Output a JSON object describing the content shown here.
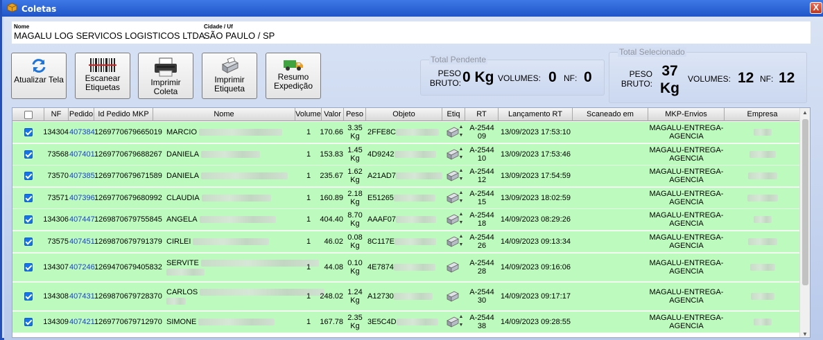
{
  "window": {
    "title": "Coletas",
    "close_label": "X"
  },
  "info": {
    "nome_label": "Nome",
    "nome_value": "MAGALU LOG SERVICOS LOGISTICOS LTDA",
    "cidade_label": "Cidade / Uf",
    "cidade_value": "SÃO PAULO / SP"
  },
  "toolbar": {
    "atualizar": "Atualizar Tela",
    "escanear": "Escanear Etiquetas",
    "imprimir_coleta": "Imprimir Coleta",
    "imprimir_etiqueta": "Imprimir Etiqueta",
    "resumo": "Resumo Expedição"
  },
  "pendente": {
    "title": "Total Pendente",
    "peso_label": "PESO BRUTO:",
    "peso_value": "0 Kg",
    "volumes_label": "VOLUMES:",
    "volumes_value": "0",
    "nf_label": "NF:",
    "nf_value": "0"
  },
  "selecionado": {
    "title": "Total Selecionado",
    "peso_label": "PESO BRUTO:",
    "peso_value": "37 Kg",
    "volumes_label": "VOLUMES:",
    "volumes_value": "12",
    "nf_label": "NF:",
    "nf_value": "12"
  },
  "columns": {
    "nf": "NF",
    "pedido": "Pedido",
    "id_mkp": "Id Pedido MKP",
    "nome": "Nome",
    "volume": "Volume",
    "valor": "Valor",
    "peso": "Peso",
    "objeto": "Objeto",
    "etiq": "Etiq",
    "rt": "RT",
    "lancamento": "Lançamento RT",
    "scaneado": "Scaneado em",
    "mkp_envios": "MKP-Envios",
    "empresa": "Empresa"
  },
  "rows": [
    {
      "nf": "134304",
      "pedido": "407384",
      "id_mkp": "1269770679665019",
      "nome": "MARCIO",
      "volume": "1",
      "valor": "170.66",
      "peso": "3.35 Kg",
      "objeto": "2FFE8C",
      "rt": "A-254409",
      "lancamento": "13/09/2023 17:53:10",
      "mkp": "MAGALU-ENTREGA-AGENCIA"
    },
    {
      "nf": "73568",
      "pedido": "407401",
      "id_mkp": "1269770679688267",
      "nome": "DANIELA",
      "volume": "1",
      "valor": "153.83",
      "peso": "1.45 Kg",
      "objeto": "4D9242",
      "rt": "A-254410",
      "lancamento": "13/09/2023 17:53:46",
      "mkp": "MAGALU-ENTREGA-AGENCIA"
    },
    {
      "nf": "73570",
      "pedido": "407385",
      "id_mkp": "1269770679671589",
      "nome": "DANIELA",
      "volume": "1",
      "valor": "235.67",
      "peso": "1.62 Kg",
      "objeto": "A21AD7",
      "rt": "A-254412",
      "lancamento": "13/09/2023 17:54:59",
      "mkp": "MAGALU-ENTREGA-AGENCIA"
    },
    {
      "nf": "73571",
      "pedido": "407396",
      "id_mkp": "1269770679680992",
      "nome": "CLAUDIA",
      "volume": "1",
      "valor": "160.89",
      "peso": "2.18 Kg",
      "objeto": "E51265",
      "rt": "A-254415",
      "lancamento": "13/09/2023 18:02:59",
      "mkp": "MAGALU-ENTREGA-AGENCIA"
    },
    {
      "nf": "134306",
      "pedido": "407447",
      "id_mkp": "1269870679755845",
      "nome": "ANGELA",
      "volume": "1",
      "valor": "404.40",
      "peso": "8.70 Kg",
      "objeto": "AAAF07",
      "rt": "A-254418",
      "lancamento": "14/09/2023 08:29:26",
      "mkp": "MAGALU-ENTREGA-AGENCIA"
    },
    {
      "nf": "73575",
      "pedido": "407451",
      "id_mkp": "1269870679791379",
      "nome": "CIRLEI",
      "volume": "1",
      "valor": "46.02",
      "peso": "0.08 Kg",
      "objeto": "8C117E",
      "rt": "A-254426",
      "lancamento": "14/09/2023 09:13:34",
      "mkp": "MAGALU-ENTREGA-AGENCIA"
    },
    {
      "nf": "134307",
      "pedido": "407246",
      "id_mkp": "1269470679405832",
      "nome": "SERVITE",
      "volume": "1",
      "valor": "44.08",
      "peso": "0.10 Kg",
      "objeto": "4E7874",
      "rt": "A-254428",
      "lancamento": "14/09/2023 09:16:06",
      "mkp": "MAGALU-ENTREGA-AGENCIA"
    },
    {
      "nf": "134308",
      "pedido": "407431",
      "id_mkp": "1269870679728370",
      "nome": "CARLOS",
      "volume": "1",
      "valor": "248.02",
      "peso": "1.24 Kg",
      "objeto": "A12730",
      "rt": "A-254430",
      "lancamento": "14/09/2023 09:17:17",
      "mkp": "MAGALU-ENTREGA-AGENCIA"
    },
    {
      "nf": "134309",
      "pedido": "407421",
      "id_mkp": "1269770679712970",
      "nome": "SIMONE",
      "volume": "1",
      "valor": "167.78",
      "peso": "2.35 Kg",
      "objeto": "3E5C4D",
      "rt": "A-254438",
      "lancamento": "14/09/2023 09:28:55",
      "mkp": "MAGALU-ENTREGA-AGENCIA"
    }
  ]
}
